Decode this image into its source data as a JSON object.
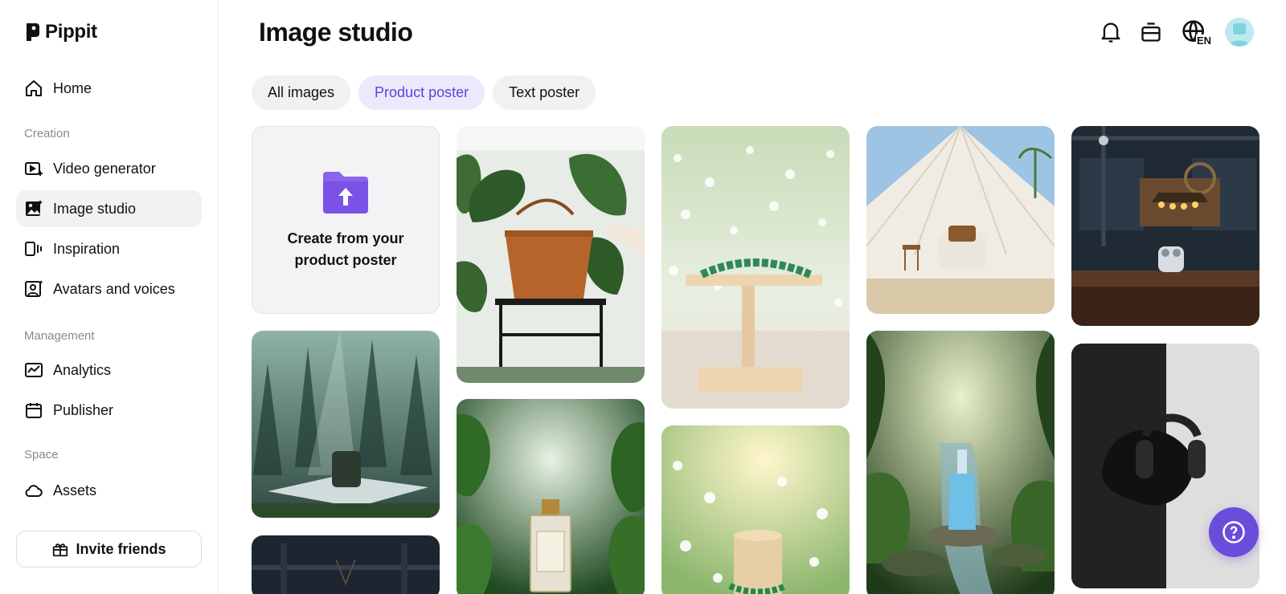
{
  "app": {
    "brand": "Pippit"
  },
  "sidebar": {
    "home": "Home",
    "sections": {
      "creation": "Creation",
      "management": "Management",
      "space": "Space"
    },
    "items": {
      "video_generator": "Video generator",
      "image_studio": "Image studio",
      "inspiration": "Inspiration",
      "avatars_voices": "Avatars and voices",
      "analytics": "Analytics",
      "publisher": "Publisher",
      "assets": "Assets"
    },
    "invite": "Invite friends"
  },
  "header": {
    "title": "Image studio",
    "language": "EN"
  },
  "tabs": [
    "All images",
    "Product poster",
    "Text poster"
  ],
  "active_tab": "Product poster",
  "create_card": {
    "line1": "Create from your",
    "line2": "product poster"
  },
  "accent": "#6a4ddb",
  "icons": [
    "bell-icon",
    "subscription-icon",
    "globe-icon",
    "help-icon",
    "upload-folder-icon"
  ]
}
